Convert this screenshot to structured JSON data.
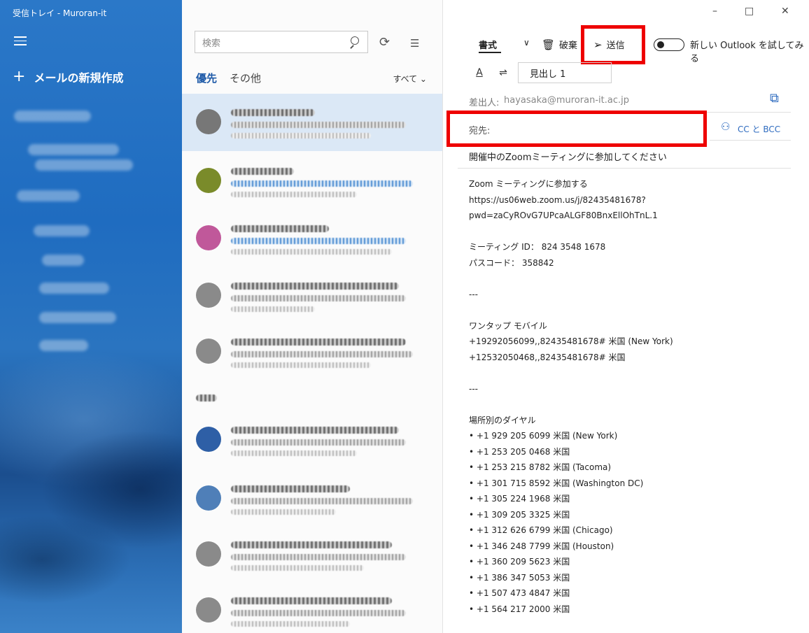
{
  "window": {
    "title": "受信トレイ - Muroran-it",
    "controls": {
      "minimize": "–",
      "maximize": "□",
      "close": "✕"
    }
  },
  "sidebar": {
    "compose_label": "メールの新規作成",
    "compose_icon": "plus-icon",
    "menu_icon": "hamburger-icon"
  },
  "list": {
    "search_placeholder": "検索",
    "tabs": [
      {
        "label": "優先",
        "active": true
      },
      {
        "label": "その他",
        "active": false
      }
    ],
    "filter_label": "すべて ⌄",
    "avatar_colors": [
      "#777777",
      "#7a8b2a",
      "#c0589a",
      "#8a8a8a",
      "#8a8a8a",
      "#e8e8e8",
      "#2e5fa6",
      "#4f7fb8",
      "#8a8a8a",
      "#8a8a8a"
    ]
  },
  "compose": {
    "tab_label": "書式",
    "discard_label": "破棄",
    "send_label": "送信",
    "toggle_label": "新しい Outlook を試してみる",
    "style_value": "見出し 1",
    "from_label": "差出人:",
    "from_value": "hayasaka@muroran-it.ac.jp",
    "to_label": "宛先:",
    "cc_label": "CC と BCC",
    "subject": "開催中のZoomミーティングに参加してください",
    "highlight_color": "#ee0000",
    "body_lines": [
      "Zoom ミーティングに参加する",
      "https://us06web.zoom.us/j/82435481678?",
      "pwd=zaCyROvG7UPcaALGF80BnxEllOhTnL.1",
      "",
      "ミーティング ID： 824 3548 1678",
      "パスコード： 358842",
      "",
      "---",
      "",
      "ワンタップ モバイル",
      "+19292056099,,82435481678# 米国 (New York)",
      "+12532050468,,82435481678# 米国",
      "",
      "---",
      "",
      "場所別のダイヤル",
      "• +1 929 205 6099 米国 (New York)",
      "• +1 253 205 0468 米国",
      "• +1 253 215 8782 米国 (Tacoma)",
      "• +1 301 715 8592 米国 (Washington DC)",
      "• +1 305 224 1968 米国",
      "• +1 309 205 3325 米国",
      "• +1 312 626 6799 米国 (Chicago)",
      "• +1 346 248 7799 米国 (Houston)",
      "• +1 360 209 5623 米国",
      "• +1 386 347 5053 米国",
      "• +1 507 473 4847 米国",
      "• +1 564 217 2000 米国"
    ]
  }
}
